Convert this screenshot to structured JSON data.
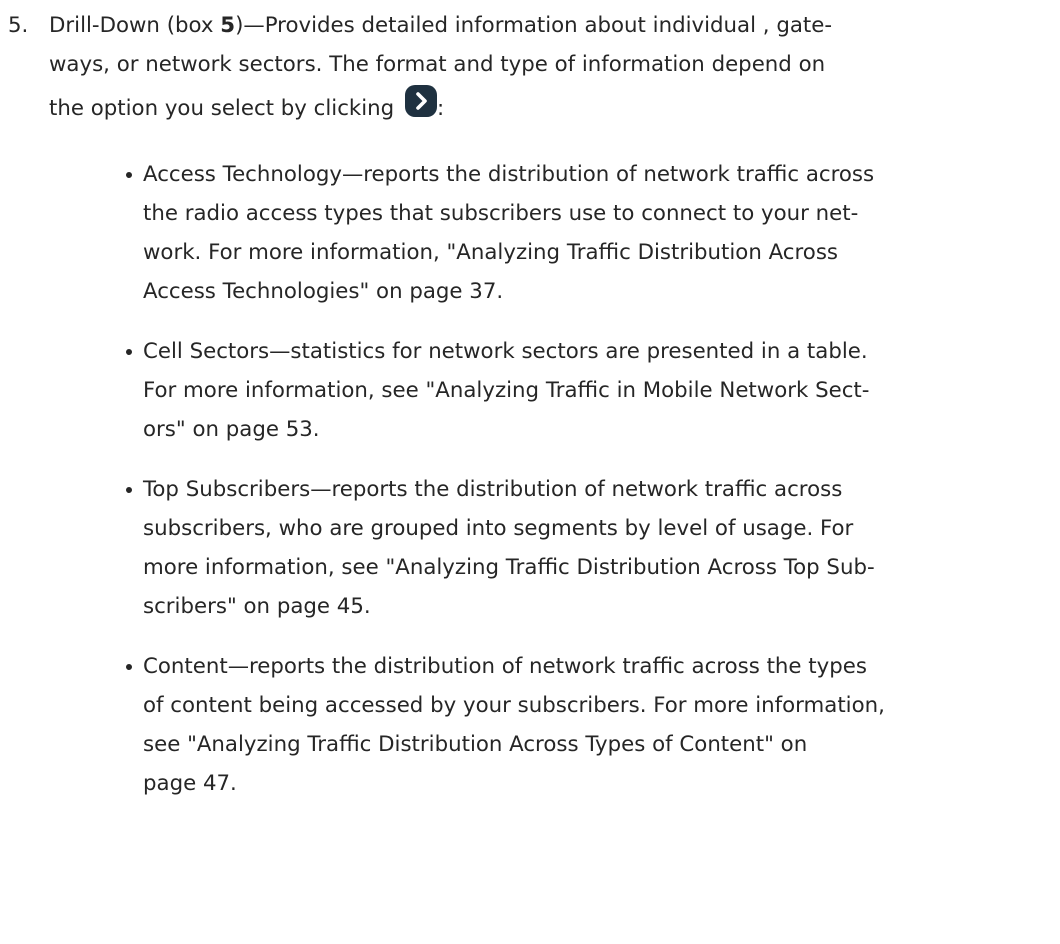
{
  "item": {
    "number": "5.",
    "lines": [
      "Drill-Down (box ",
      "5",
      ")—Provides detailed information about individual , gate-",
      "ways, or network sectors. The format and type of information depend on",
      "the option you select by clicking ",
      ":"
    ],
    "icon": "chevron-right-icon"
  },
  "bullets": [
    {
      "lines": [
        "Access Technology—reports the distribution of network traffic across",
        "the radio access types that subscribers use to connect to your net-",
        "work. For more information, \"Analyzing Traffic Distribution Across",
        "Access Technologies\" on page 37."
      ]
    },
    {
      "lines": [
        "Cell Sectors—statistics for network sectors are presented in a table.",
        "For more information, see \"Analyzing Traffic in Mobile Network Sect-",
        "ors\" on page 53."
      ]
    },
    {
      "lines": [
        "Top Subscribers—reports the distribution of network traffic across",
        "subscribers, who are grouped into segments by level of usage. For",
        "more information, see \"Analyzing Traffic Distribution Across Top Sub-",
        "scribers\" on page 45."
      ]
    },
    {
      "lines": [
        "Content—reports the distribution of network traffic across the types",
        "of content being accessed by your subscribers. For more information,",
        "see \"Analyzing Traffic Distribution Across Types of Content\" on",
        "page 47."
      ]
    }
  ]
}
